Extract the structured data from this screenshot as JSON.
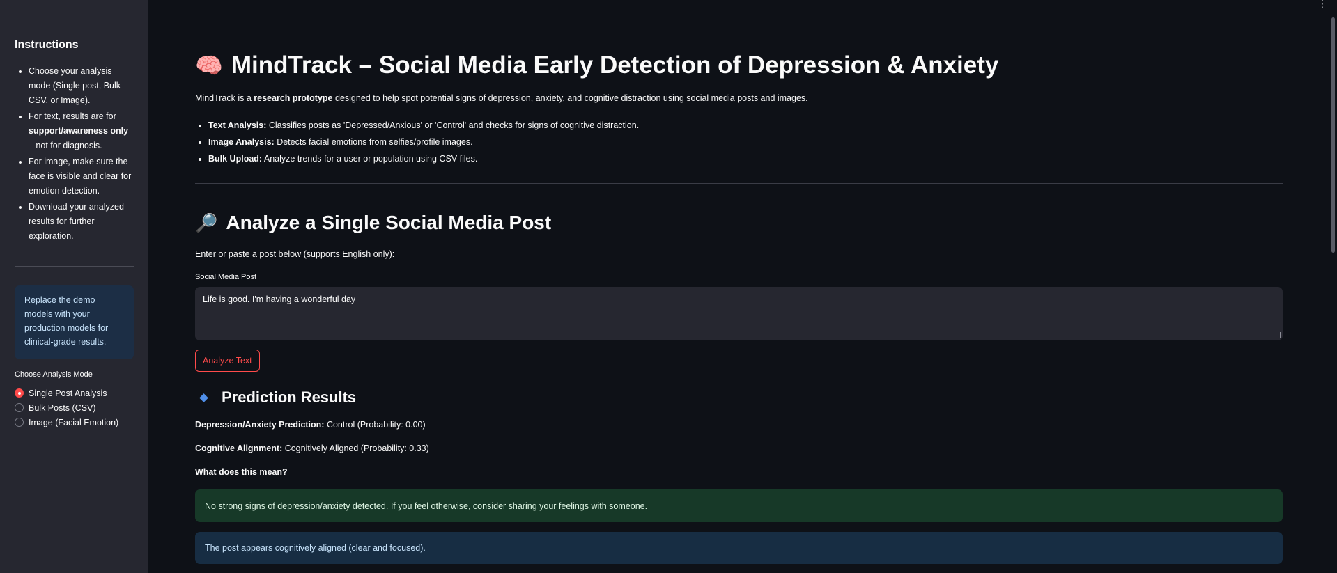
{
  "sidebar": {
    "title": "Instructions",
    "items": [
      {
        "pre": "Choose your analysis mode (Single post, Bulk CSV, or Image).",
        "bold": "",
        "post": ""
      },
      {
        "pre": "For text, results are for ",
        "bold": "support/awareness only",
        "post": " – not for diagnosis."
      },
      {
        "pre": "For image, make sure the face is visible and clear for emotion detection.",
        "bold": "",
        "post": ""
      },
      {
        "pre": "Download your analyzed results for further exploration.",
        "bold": "",
        "post": ""
      }
    ],
    "info_box": "Replace the demo models with your production models for clinical-grade results.",
    "mode_label": "Choose Analysis Mode",
    "modes": [
      "Single Post Analysis",
      "Bulk Posts (CSV)",
      "Image (Facial Emotion)"
    ],
    "selected_mode": "Single Post Analysis"
  },
  "header": {
    "emoji": "🧠",
    "title": "MindTrack – Social Media Early Detection of Depression & Anxiety",
    "intro_pre": "MindTrack is a ",
    "intro_bold": "research prototype",
    "intro_post": " designed to help spot potential signs of depression, anxiety, and cognitive distraction using social media posts and images.",
    "features": [
      {
        "label": "Text Analysis:",
        "text": " Classifies posts as 'Depressed/Anxious' or 'Control' and checks for signs of cognitive distraction."
      },
      {
        "label": "Image Analysis:",
        "text": " Detects facial emotions from selfies/profile images."
      },
      {
        "label": "Bulk Upload:",
        "text": " Analyze trends for a user or population using CSV files."
      }
    ]
  },
  "single_post": {
    "emoji": "🔎",
    "heading": "Analyze a Single Social Media Post",
    "instructions": "Enter or paste a post below (supports English only):",
    "field_label": "Social Media Post",
    "field_value": "Life is good. I'm having a wonderful day",
    "button_label": "Analyze Text"
  },
  "results": {
    "heading": "Prediction Results",
    "depression_label": "Depression/Anxiety Prediction:",
    "depression_value": " Control (Probability: 0.00)",
    "cognitive_label": "Cognitive Alignment:",
    "cognitive_value": " Cognitively Aligned (Probability: 0.33)",
    "meaning_label": "What does this mean?",
    "success_message": "No strong signs of depression/anxiety detected. If you feel otherwise, consider sharing your feelings with someone.",
    "info_message": "The post appears cognitively aligned (clear and focused)."
  },
  "menu_icon": "⋮",
  "colors": {
    "background": "#0e1117",
    "sidebar": "#262730",
    "accent": "#ff4b4b",
    "success_bg": "#173928",
    "info_bg": "#172d43"
  }
}
